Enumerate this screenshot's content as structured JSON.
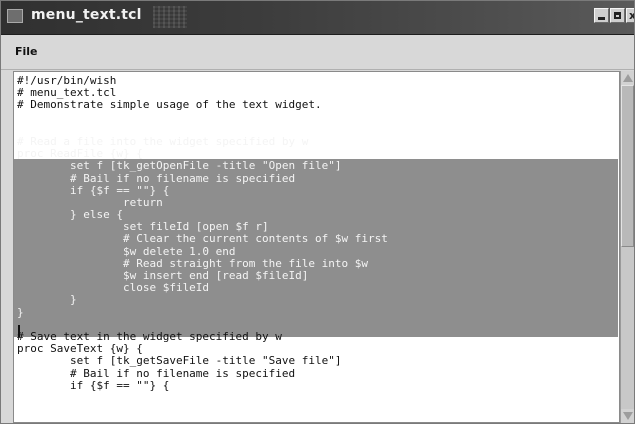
{
  "window": {
    "title": "menu_text.tcl",
    "controls": [
      "minimize",
      "maximize",
      "close"
    ],
    "close_glyph": "x"
  },
  "menubar": {
    "items": [
      {
        "label": "File"
      }
    ]
  },
  "editor": {
    "lines_before": [
      "#!/usr/bin/wish",
      "# menu_text.tcl",
      "# Demonstrate simple usage of the text widget.",
      "",
      ""
    ],
    "selected_lines": [
      "# Read a file into the widget specified by w",
      "proc ReadFile {w} {",
      "        set f [tk_getOpenFile -title \"Open file\"]",
      "        # Bail if no filename is specified",
      "        if {$f == \"\"} {",
      "                return",
      "        } else {",
      "                set fileId [open $f r]",
      "                # Clear the current contents of $w first",
      "                $w delete 1.0 end",
      "                # Read straight from the file into $w",
      "                $w insert end [read $fileId]",
      "                close $fileId",
      "        }",
      "}"
    ],
    "lines_after": [
      "",
      "# Save text in the widget specified by w",
      "proc SaveText {w} {",
      "        set f [tk_getSaveFile -title \"Save file\"]",
      "        # Bail if no filename is specified",
      "        if {$f == \"\"} {"
    ]
  },
  "colors": {
    "selection_bg": "#8e8e8e",
    "selection_fg": "#f4f4f4",
    "titlebar": "#303030"
  },
  "scrollbar": {
    "position_fraction": 0.0,
    "visible_fraction": 0.5
  }
}
